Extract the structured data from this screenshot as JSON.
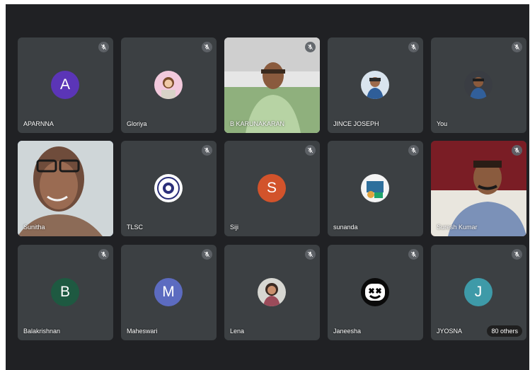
{
  "colors": {
    "background": "#202124",
    "tile": "#3c4043",
    "avatar_a": "#5b35b7",
    "avatar_s": "#d2532b",
    "avatar_b": "#1e5941",
    "avatar_m": "#5c6bc0",
    "avatar_j": "#3e9aa8",
    "active_outline": "#8ab4f8"
  },
  "participants": [
    {
      "name": "APARNNA",
      "initial": "A",
      "muted": true
    },
    {
      "name": "Gloriya",
      "muted": true
    },
    {
      "name": "B KARUNAKARAN",
      "muted": true
    },
    {
      "name": "JINCE JOSEPH",
      "muted": true
    },
    {
      "name": "You",
      "muted": true
    },
    {
      "name": "Sunitha",
      "muted": false,
      "active": true
    },
    {
      "name": "TLSC",
      "muted": true
    },
    {
      "name": "Siji",
      "initial": "S",
      "muted": true
    },
    {
      "name": "sunanda",
      "muted": true
    },
    {
      "name": "Suresh Kumar",
      "muted": true
    },
    {
      "name": "Balakrishnan",
      "initial": "B",
      "muted": true
    },
    {
      "name": "Maheswari",
      "initial": "M",
      "muted": true
    },
    {
      "name": "Lena",
      "muted": true
    },
    {
      "name": "Janeesha",
      "muted": true
    },
    {
      "name": "JYOSNA",
      "initial": "J",
      "muted": true
    }
  ],
  "others_label": "80 others"
}
